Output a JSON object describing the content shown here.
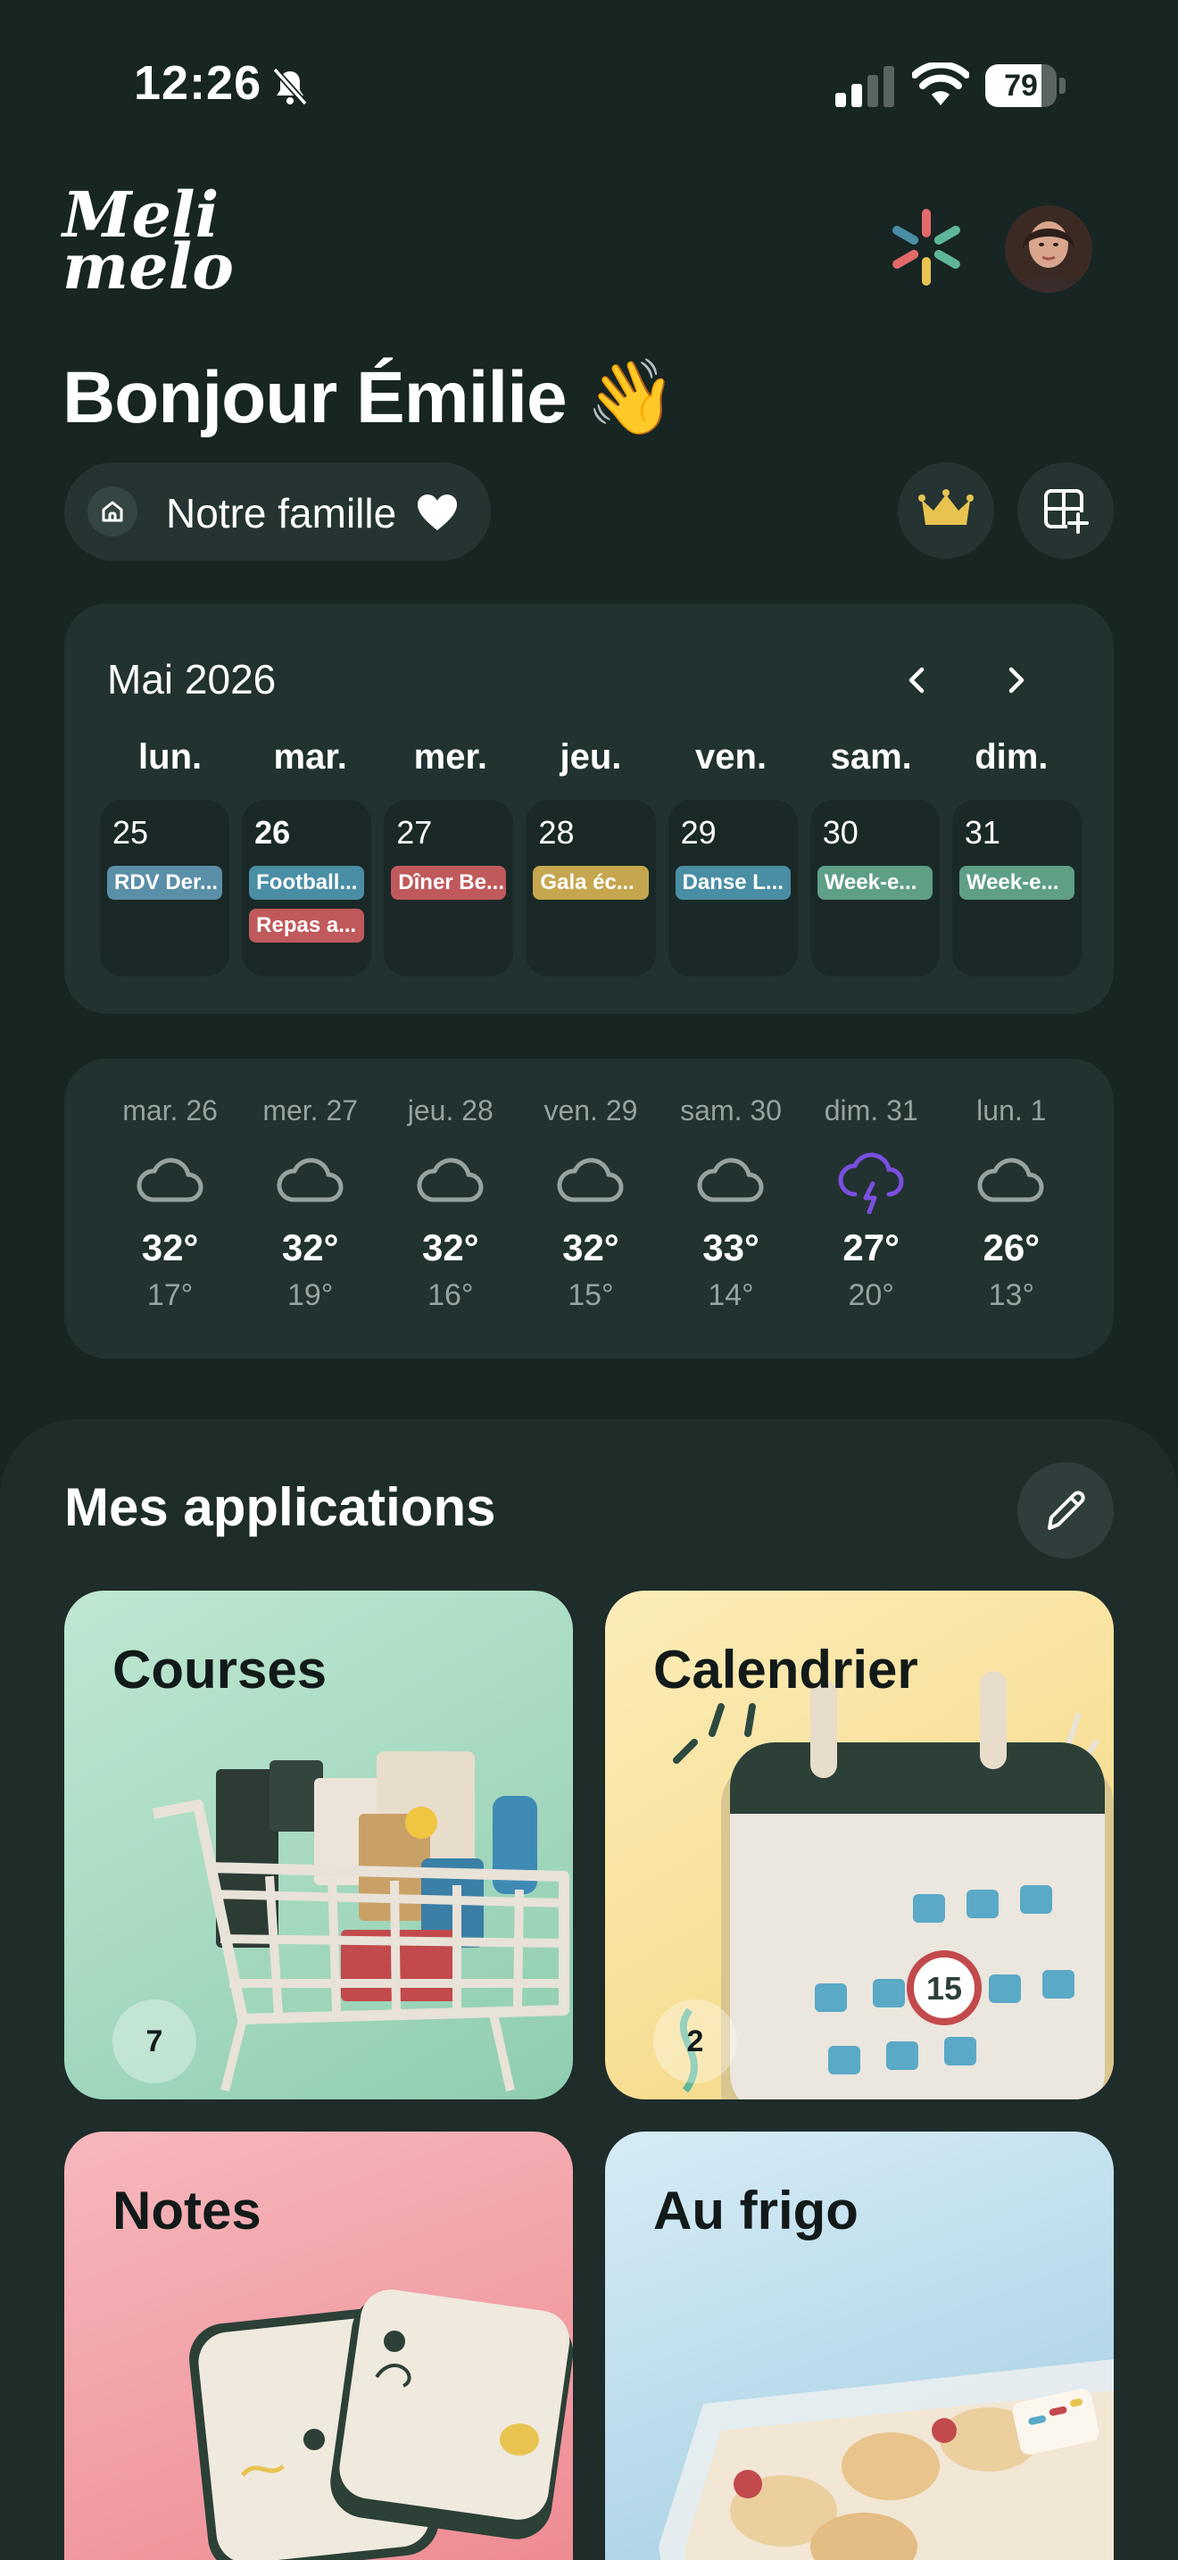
{
  "status_bar": {
    "time": "12:26",
    "battery": "79",
    "battery_level": 0.79
  },
  "header": {
    "logo_line1": "Meli",
    "logo_line2": "melo",
    "greeting": "Bonjour Émilie 👋",
    "family_label": "Notre famille"
  },
  "calendar": {
    "title": "Mai 2026",
    "weekdays": [
      "lun.",
      "mar.",
      "mer.",
      "jeu.",
      "ven.",
      "sam.",
      "dim."
    ],
    "days": [
      {
        "num": "25",
        "events": [
          {
            "label": "RDV Der...",
            "color": "#5b8fa8"
          }
        ]
      },
      {
        "num": "26",
        "today": true,
        "events": [
          {
            "label": "Football...",
            "color": "#4a8ea5"
          },
          {
            "label": "Repas a...",
            "color": "#c0595b"
          }
        ]
      },
      {
        "num": "27",
        "events": [
          {
            "label": "Dîner Be...",
            "color": "#c0595b"
          }
        ]
      },
      {
        "num": "28",
        "events": [
          {
            "label": "Gala éc...",
            "color": "#c6a64f"
          }
        ]
      },
      {
        "num": "29",
        "events": [
          {
            "label": "Danse L...",
            "color": "#4a8ea5"
          }
        ]
      },
      {
        "num": "30",
        "events": [
          {
            "label": "Week-e...",
            "color": "#5f9f86"
          }
        ]
      },
      {
        "num": "31",
        "events": [
          {
            "label": "Week-e...",
            "color": "#5f9f86"
          }
        ]
      }
    ]
  },
  "weather": [
    {
      "day": "mar. 26",
      "high": "32°",
      "low": "17°",
      "icon": "cloud-icon"
    },
    {
      "day": "mer. 27",
      "high": "32°",
      "low": "19°",
      "icon": "cloud-icon"
    },
    {
      "day": "jeu. 28",
      "high": "32°",
      "low": "16°",
      "icon": "cloud-icon"
    },
    {
      "day": "ven. 29",
      "high": "32°",
      "low": "15°",
      "icon": "cloud-icon"
    },
    {
      "day": "sam. 30",
      "high": "33°",
      "low": "14°",
      "icon": "cloud-icon"
    },
    {
      "day": "dim. 31",
      "high": "27°",
      "low": "20°",
      "icon": "storm-icon"
    },
    {
      "day": "lun. 1",
      "high": "26°",
      "low": "13°",
      "icon": "cloud-icon"
    }
  ],
  "apps": {
    "title": "Mes applications",
    "tiles": [
      {
        "key": "courses",
        "title": "Courses",
        "badge": "7"
      },
      {
        "key": "calendrier",
        "title": "Calendrier",
        "badge": "2"
      },
      {
        "key": "notes",
        "title": "Notes"
      },
      {
        "key": "frigo",
        "title": "Au frigo"
      }
    ]
  },
  "colors": {
    "background": "#172523",
    "card": "#213230",
    "accent_purple": "#7b4fe0",
    "crown": "#e8c350"
  }
}
